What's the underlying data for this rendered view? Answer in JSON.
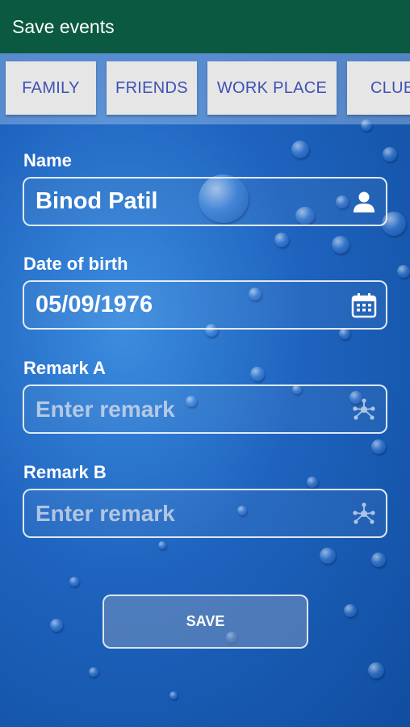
{
  "appbar": {
    "title": "Save events"
  },
  "tabs": [
    {
      "label": "FAMILY"
    },
    {
      "label": "FRIENDS"
    },
    {
      "label": "WORK PLACE"
    },
    {
      "label": "CLUB"
    }
  ],
  "form": {
    "name": {
      "label": "Name",
      "value": "Binod  Patil",
      "icon": "person-icon"
    },
    "dob": {
      "label": "Date of birth",
      "value": "05/09/1976",
      "icon": "calendar-icon"
    },
    "remark_a": {
      "label": "Remark A",
      "placeholder": "Enter remark",
      "icon": "share-nodes-icon"
    },
    "remark_b": {
      "label": "Remark B",
      "placeholder": "Enter remark",
      "icon": "share-nodes-icon"
    }
  },
  "save_button": {
    "label": "SAVE"
  }
}
